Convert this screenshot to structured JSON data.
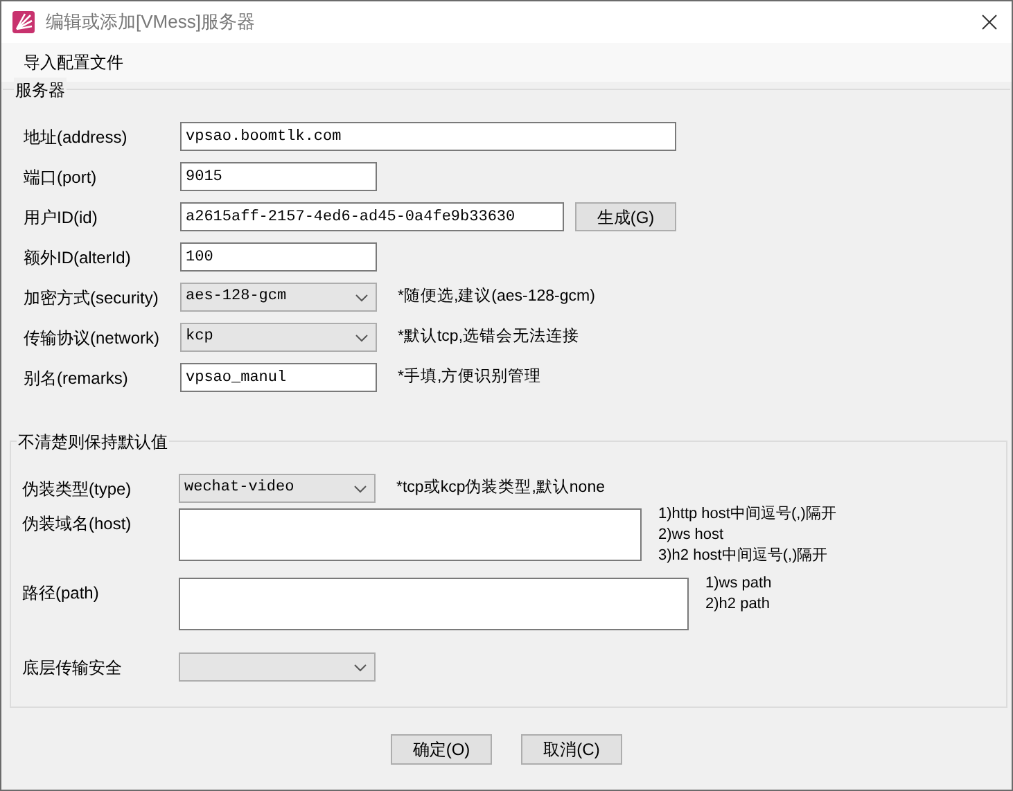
{
  "window": {
    "title": "编辑或添加[VMess]服务器"
  },
  "menu": [
    "导入配置文件"
  ],
  "server": {
    "title": "服务器",
    "rows": [
      {
        "kind": "text",
        "label": "地址(address)",
        "value": "vpsao.boomtlk.com"
      },
      {
        "kind": "text",
        "label": "端口(port)",
        "value": "9015"
      },
      {
        "kind": "text",
        "label": "用户ID(id)",
        "value": "a2615aff-2157-4ed6-ad45-0a4fe9b33630",
        "button": "生成(G)"
      },
      {
        "kind": "text",
        "label": "额外ID(alterId)",
        "value": "100"
      },
      {
        "kind": "select",
        "label": "加密方式(security)",
        "value": "aes-128-gcm",
        "hint": "*随便选,建议(aes-128-gcm)"
      },
      {
        "kind": "select",
        "label": "传输协议(network)",
        "value": "kcp",
        "hint": "*默认tcp,选错会无法连接"
      },
      {
        "kind": "text",
        "label": "别名(remarks)",
        "value": "vpsao_manul",
        "hint": "*手填,方便识别管理"
      }
    ]
  },
  "advanced": {
    "title": "不清楚则保持默认值",
    "rows": [
      {
        "kind": "select",
        "label": "伪装类型(type)",
        "value": "wechat-video",
        "hint": "*tcp或kcp伪装类型,默认none"
      },
      {
        "kind": "area",
        "label": "伪装域名(host)",
        "hints": [
          "1)http host中间逗号(,)隔开",
          "2)ws host",
          "3)h2 host中间逗号(,)隔开"
        ]
      },
      {
        "kind": "area",
        "label": "路径(path)",
        "hints": [
          "1)ws path",
          "2)h2 path"
        ]
      },
      {
        "kind": "select",
        "label": "底层传输安全"
      }
    ]
  },
  "buttons": [
    "确定(O)",
    "取消(C)"
  ]
}
